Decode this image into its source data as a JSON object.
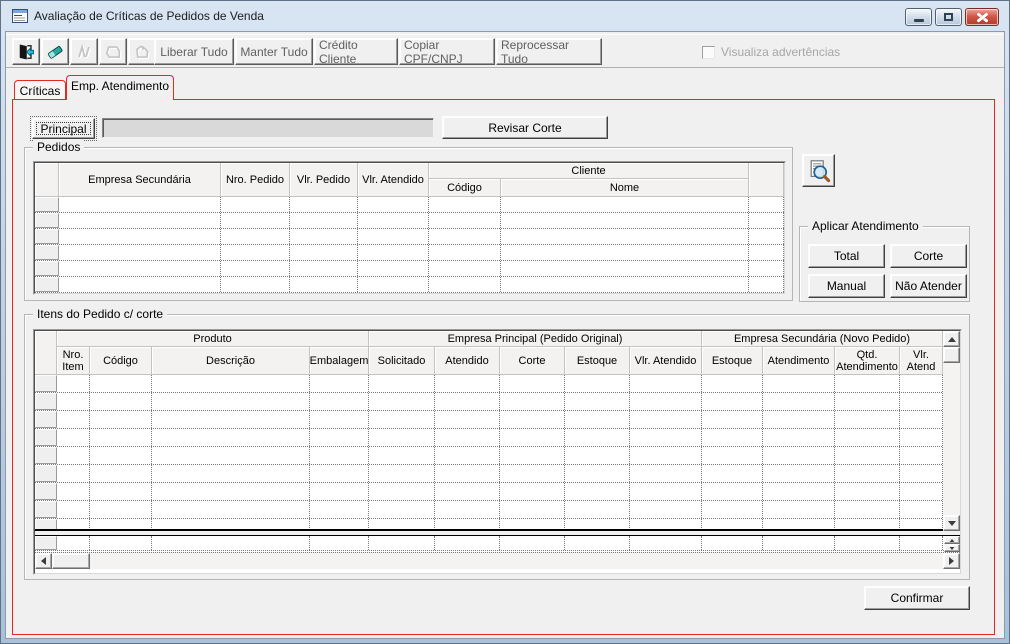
{
  "colors": {
    "accent_red": "#e02b22",
    "titlebar_top": "#d9e5f3",
    "titlebar_bottom": "#a8c0da",
    "client_bg": "#f0f0f0",
    "close_button_red": "#c8473a",
    "disabled_text": "#a6a6a6"
  },
  "window": {
    "title": "Avaliação de Críticas de Pedidos de Venda",
    "icon": "form-icon",
    "controls": {
      "minimize": "minimize-icon",
      "maximize": "maximize-icon",
      "close": "close-icon"
    }
  },
  "toolbar": {
    "icon_buttons": [
      {
        "name": "exit-icon",
        "enabled": true
      },
      {
        "name": "eraser-icon",
        "enabled": true
      },
      {
        "name": "disabled-tool-icon-1",
        "enabled": false
      },
      {
        "name": "disabled-tool-icon-2",
        "enabled": false
      },
      {
        "name": "disabled-tool-icon-3",
        "enabled": false
      }
    ],
    "buttons": [
      "Liberar Tudo",
      "Manter Tudo",
      "Crédito Cliente",
      "Copiar  CPF/CNPJ",
      "Reprocessar Tudo"
    ],
    "checkbox": {
      "label": "Visualiza advertências",
      "checked": false,
      "enabled": false
    }
  },
  "tabs": [
    {
      "label": "Críticas",
      "active": false
    },
    {
      "label": "Emp. Atendimento",
      "active": true
    }
  ],
  "header_bar": {
    "principal_button": "Principal",
    "empresa_field": {
      "value": "",
      "disabled": true
    },
    "revisar_corte_button": "Revisar Corte"
  },
  "pedidos": {
    "group_title": "Pedidos",
    "header": {
      "empresa_secundaria": "Empresa Secundária",
      "nro_pedido": "Nro. Pedido",
      "vlr_pedido": "Vlr. Pedido",
      "vlr_atendido": "Vlr. Atendido",
      "cliente_group": "Cliente",
      "codigo": "Código",
      "nome": "Nome"
    },
    "rows": []
  },
  "aplicar_atendimento": {
    "group_title": "Aplicar Atendimento",
    "buttons": [
      "Total",
      "Corte",
      "Manual",
      "Não Atender"
    ]
  },
  "itens": {
    "group_title": "Itens do Pedido c/ corte",
    "column_groups": [
      "Produto",
      "Empresa Principal (Pedido Original)",
      "Empresa Secundária (Novo Pedido)"
    ],
    "columns": [
      "Nro. Item",
      "Código",
      "Descrição",
      "Embalagem",
      "Solicitado",
      "Atendido",
      "Corte",
      "Estoque",
      "Vlr. Atendido",
      "Estoque",
      "Atendimento",
      "Qtd. Atendimento",
      "Vlr. Atend"
    ],
    "rows": []
  },
  "footer": {
    "confirm_button": "Confirmar"
  }
}
